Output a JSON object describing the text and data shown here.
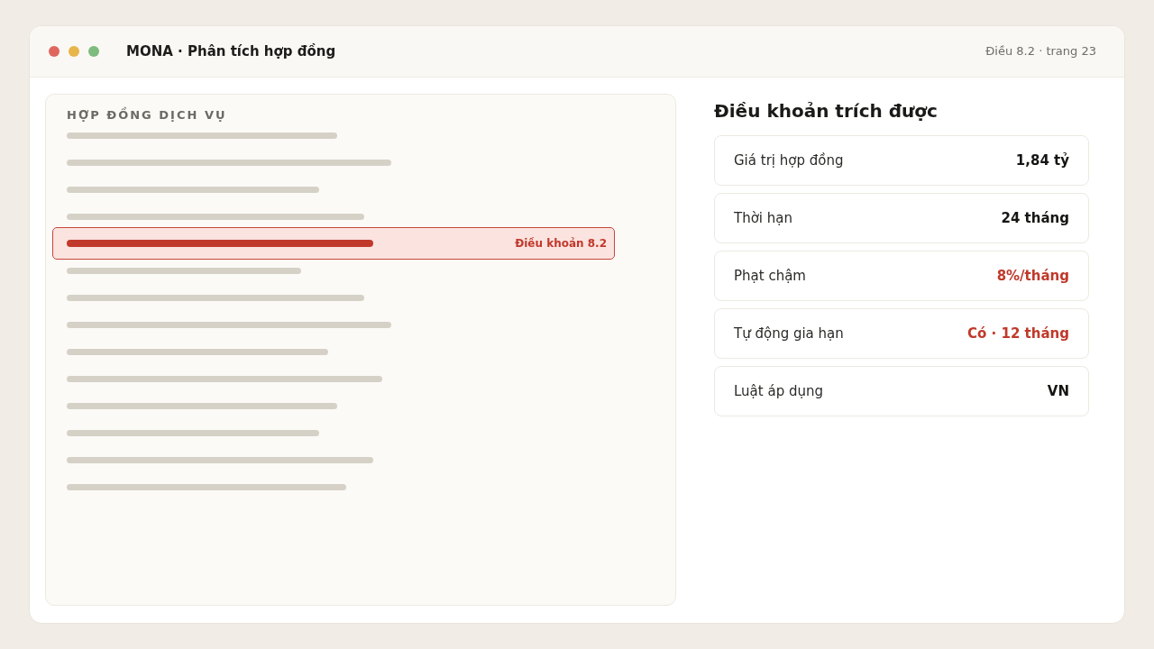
{
  "window": {
    "title": "MONA · Phân tích hợp đồng",
    "location": "Điều 8.2 · trang 23"
  },
  "document": {
    "heading": "HỢP ĐỒNG DỊCH VỤ",
    "lines": [
      {
        "highlighted": false
      },
      {
        "highlighted": false
      },
      {
        "highlighted": false
      },
      {
        "highlighted": false
      },
      {
        "highlighted": true,
        "label": "Điều khoản 8.2"
      },
      {
        "highlighted": false
      },
      {
        "highlighted": false
      },
      {
        "highlighted": false
      },
      {
        "highlighted": false
      },
      {
        "highlighted": false
      },
      {
        "highlighted": false
      },
      {
        "highlighted": false
      },
      {
        "highlighted": false
      },
      {
        "highlighted": false
      }
    ]
  },
  "extracted": {
    "title": "Điều khoản trích được",
    "fields": [
      {
        "label": "Giá trị hợp đồng",
        "value": "1,84 tỷ",
        "flagged": false
      },
      {
        "label": "Thời hạn",
        "value": "24 tháng",
        "flagged": false
      },
      {
        "label": "Phạt chậm",
        "value": "8%/tháng",
        "flagged": true
      },
      {
        "label": "Tự động gia hạn",
        "value": "Có · 12 tháng",
        "flagged": true
      },
      {
        "label": "Luật áp dụng",
        "value": "VN",
        "flagged": false
      }
    ]
  }
}
